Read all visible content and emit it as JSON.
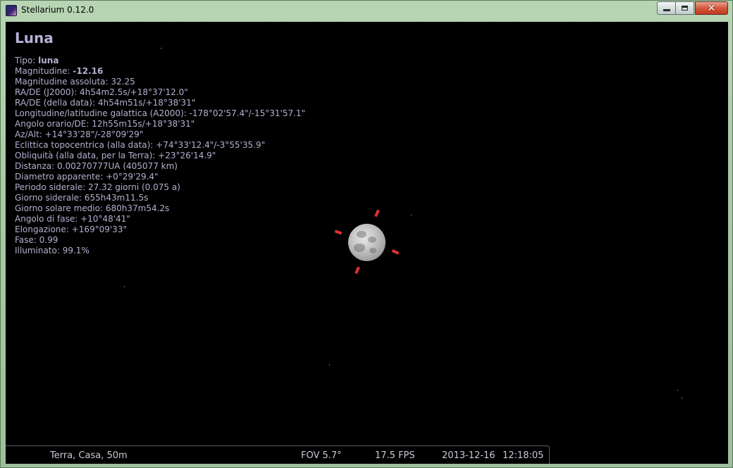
{
  "window": {
    "title": "Stellarium 0.12.0",
    "icon": "stellarium-app-icon"
  },
  "object_info": {
    "title": "Luna",
    "lines": [
      {
        "label": "Tipo: ",
        "value": "luna",
        "bold": true
      },
      {
        "label": "Magnitudine: ",
        "value": "-12.16",
        "bold": true
      },
      {
        "label": "Magnitudine assoluta: ",
        "value": "32.25"
      },
      {
        "label": "RA/DE (J2000): ",
        "value": "4h54m2.5s/+18°37'12.0\""
      },
      {
        "label": "RA/DE (della data): ",
        "value": "4h54m51s/+18°38'31\""
      },
      {
        "label": "Longitudine/latitudine galattica (A2000): ",
        "value": "-178°02'57.4\"/-15°31'57.1\""
      },
      {
        "label": "Angolo orario/DE: ",
        "value": "12h55m15s/+18°38'31\""
      },
      {
        "label": "Az/Alt: ",
        "value": "+14°33'28\"/-28°09'29\""
      },
      {
        "label": "Eclittica topocentrica (alla data): ",
        "value": "+74°33'12.4\"/-3°55'35.9\""
      },
      {
        "label": "Obliquità (alla data, per la Terra): ",
        "value": "+23°26'14.9\""
      },
      {
        "label": "Distanza: ",
        "value": "0.00270777UA (405077 km)"
      },
      {
        "label": "Diametro apparente: ",
        "value": "+0°29'29.4\""
      },
      {
        "label": "Periodo siderale: ",
        "value": "27.32 giorni (0.075 a)"
      },
      {
        "label": "Giorno siderale: ",
        "value": "655h43m11.5s"
      },
      {
        "label": "Giorno solare medio: ",
        "value": "680h37m54.2s"
      },
      {
        "label": "Angolo di fase: ",
        "value": "+10°48'41\""
      },
      {
        "label": "Elongazione: ",
        "value": "+169°09'33\""
      },
      {
        "label": "Fase: ",
        "value": "0.99"
      },
      {
        "label": "Illuminato: ",
        "value": "99.1%"
      }
    ]
  },
  "statusbar": {
    "location": "Terra, Casa, 50m",
    "fov": "FOV 5.7°",
    "fps": "17.5 FPS",
    "date": "2013-12-16",
    "time": "12:18:05"
  },
  "colors": {
    "info_text": "#b4b0cf",
    "selection_marker": "#e03131",
    "sky": "#000000"
  }
}
